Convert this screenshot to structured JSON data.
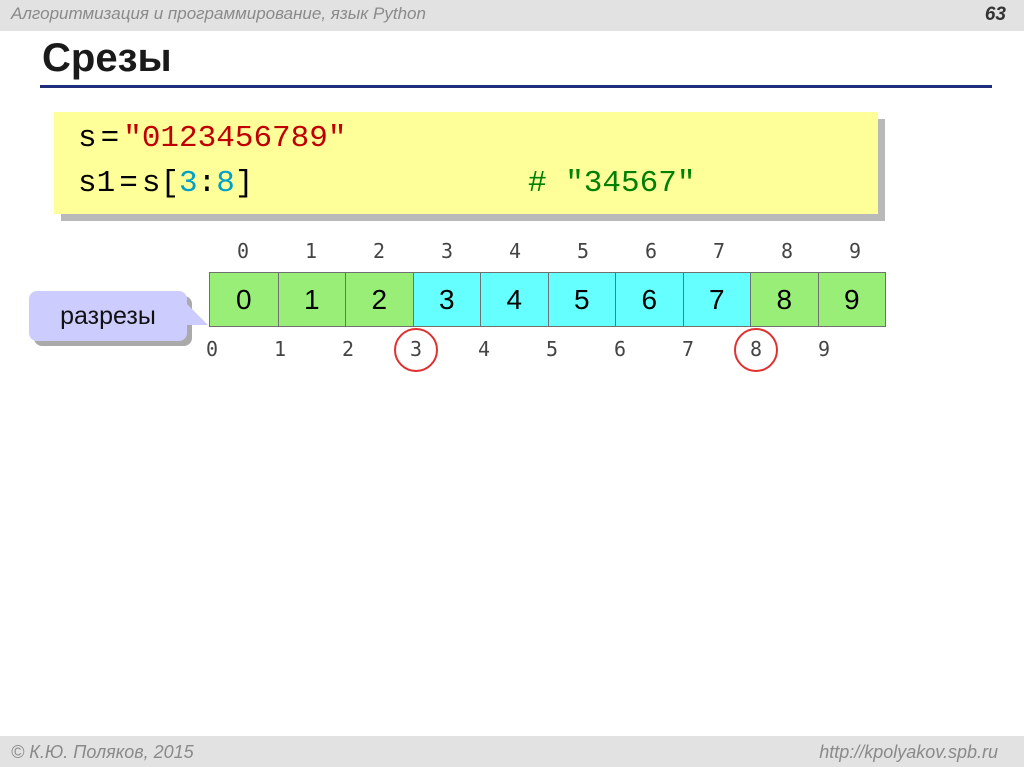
{
  "header": {
    "course_title": "Алгоритмизация и программирование, язык Python",
    "page_number": "63"
  },
  "slide": {
    "title": "Срезы"
  },
  "code": {
    "line1": {
      "var": "s",
      "op": "=",
      "value": "\"0123456789\""
    },
    "line2": {
      "var": "s1",
      "op": "=",
      "target": "s",
      "open": "[",
      "start": "3",
      "colon": ":",
      "end": "8",
      "close": "]",
      "comment": "# \"34567\""
    }
  },
  "diagram": {
    "cell_indices": [
      "0",
      "1",
      "2",
      "3",
      "4",
      "5",
      "6",
      "7",
      "8",
      "9"
    ],
    "cells": [
      {
        "text": "0",
        "color": "green"
      },
      {
        "text": "1",
        "color": "green"
      },
      {
        "text": "2",
        "color": "green"
      },
      {
        "text": "3",
        "color": "cyan"
      },
      {
        "text": "4",
        "color": "cyan"
      },
      {
        "text": "5",
        "color": "cyan"
      },
      {
        "text": "6",
        "color": "cyan"
      },
      {
        "text": "7",
        "color": "cyan"
      },
      {
        "text": "8",
        "color": "green"
      },
      {
        "text": "9",
        "color": "green"
      }
    ],
    "cut_indices": [
      "0",
      "1",
      "2",
      "3",
      "4",
      "5",
      "6",
      "7",
      "8",
      "9"
    ],
    "circled_cuts": [
      "3",
      "8"
    ],
    "callout_label": "разрезы"
  },
  "colors": {
    "code_bg": "#ffff99",
    "string": "#c00000",
    "slice_index": "#00a0c8",
    "comment": "#008000",
    "cell_green": "#99ee77",
    "cell_cyan": "#66ffff",
    "callout_bg": "#ccccff",
    "circle": "#e03030",
    "title_rule": "#1f2d7a"
  },
  "footer": {
    "copyright": "© К.Ю. Поляков, 2015",
    "url": "http://kpolyakov.spb.ru"
  }
}
